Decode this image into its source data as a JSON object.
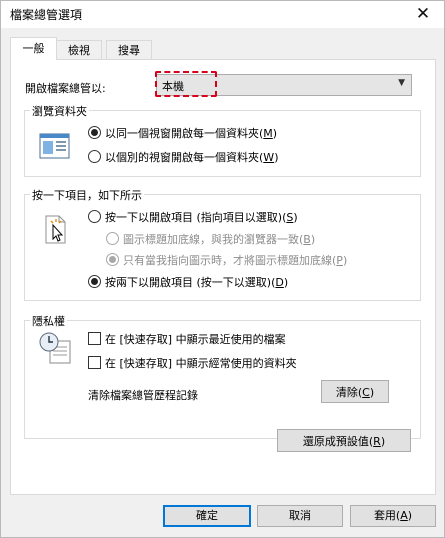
{
  "window": {
    "title": "檔案總管選項",
    "close_glyph": "✕"
  },
  "tabs": [
    {
      "label": "一般"
    },
    {
      "label": "檢視"
    },
    {
      "label": "搜尋"
    }
  ],
  "open_to": {
    "label": "開啟檔案總管以:",
    "value": "本機"
  },
  "browse": {
    "title": "瀏覽資料夾",
    "opt1_text": "以同一個視窗開啟每一個資料夾(",
    "opt1_key": "M",
    "opt2_text": "以個別的視窗開啟每一個資料夾(",
    "opt2_key": "W",
    "close_paren": ")"
  },
  "click": {
    "title": "按一下項目，如下所示",
    "single_text": "按一下以開啟項目 (指向項目以選取)(",
    "single_key": "S",
    "sub1_text": "圖示標題加底線，與我的瀏覽器一致(",
    "sub1_key": "B",
    "sub2_text": "只有當我指向圖示時，才將圖示標題加底線(",
    "sub2_key": "P",
    "double_text": "按兩下以開啟項目 (按一下以選取)(",
    "double_key": "D",
    "close_paren": ")"
  },
  "privacy": {
    "title": "隱私權",
    "recent_files": "在 [快速存取] 中顯示最近使用的檔案",
    "frequent_folders": "在 [快速存取] 中顯示經常使用的資料夾",
    "clear_label": "清除檔案總管歷程記錄",
    "clear_btn_text": "清除(",
    "clear_btn_key": "C"
  },
  "restore": {
    "text": "還原成預設值(",
    "key": "R"
  },
  "footer": {
    "ok": "確定",
    "cancel": "取消",
    "apply_text": "套用(",
    "apply_key": "A"
  },
  "state": {
    "active_tab": "一般",
    "browse_selected": "same-window",
    "click_selected": "double-click",
    "sub_selected": "point-underline",
    "recent_files_checked": false,
    "frequent_folders_checked": false
  },
  "colors": {
    "focus_dash": "#d9001b",
    "default_button_border": "#0078d7"
  }
}
